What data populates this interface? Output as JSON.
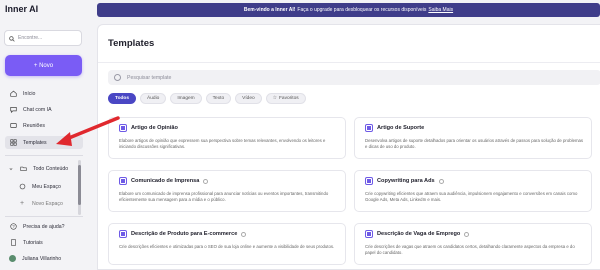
{
  "app": {
    "name": "Inner AI"
  },
  "sidebar": {
    "search_placeholder": "Encontre...",
    "new_button": "+ Novo",
    "nav": [
      {
        "label": "Início",
        "icon": "home-icon"
      },
      {
        "label": "Chat com IA",
        "icon": "chat-icon"
      },
      {
        "label": "Reuniões",
        "icon": "meeting-icon"
      },
      {
        "label": "Templates",
        "icon": "grid-icon"
      }
    ],
    "spaces": {
      "all_content": "Todo Conteúdo",
      "my_space": "Meu Espaço",
      "new_space": "Novo Espaço"
    },
    "help": "Precisa de ajuda?",
    "tutorials": "Tutoriais",
    "user": "Juliana Villarinho"
  },
  "banner": {
    "lead": "Bem-vindo a Inner AI!",
    "text": "Faça o upgrade para desbloquear os recursos disponíveis",
    "link": "Saiba Mais"
  },
  "main": {
    "title": "Templates",
    "search_placeholder": "Pesquisar template",
    "filters": [
      "Todos",
      "Áudio",
      "Imagem",
      "Texto",
      "Vídeo",
      "Favoritos"
    ],
    "cards": [
      {
        "title": "Artigo de Opinião",
        "desc": "Elabore artigos de opinião que expressem sua perspectiva sobre temas relevantes, envolvendo os leitores e iniciando discussões significativas."
      },
      {
        "title": "Artigo de Suporte",
        "desc": "Desenvolva artigos de suporte detalhados para orientar os usuários através de passos para solução de problemas e dicas de uso do produto."
      },
      {
        "title": "Comunicado de Imprensa",
        "desc": "Elabore um comunicado de imprensa profissional para anunciar notícias ou eventos importantes, transmitindo eficientemente sua mensagem para a mídia e o público."
      },
      {
        "title": "Copywriting para Ads",
        "desc": "Crie copywriting eficientes que atraem sua audiência, impulsionem engajamento e conversões em canais como Google Ads, Meta Ads, LinkedIn e mais."
      },
      {
        "title": "Descrição de Produto para E-commerce",
        "desc": "Crie descrições eficientes e otimizadas para o SEO de sua loja online e aumente a visibilidade de seus produtos."
      },
      {
        "title": "Descrição de Vaga de Emprego",
        "desc": "Crie descrições de vagas que atraem os candidatos certos, detalhando claramente aspectos da empresa e do papel do candidato."
      }
    ]
  },
  "colors": {
    "accent": "#7a5cf5",
    "banner": "#3f3d8a",
    "active_chip": "#4a47c4",
    "arrow": "#e0282e"
  }
}
